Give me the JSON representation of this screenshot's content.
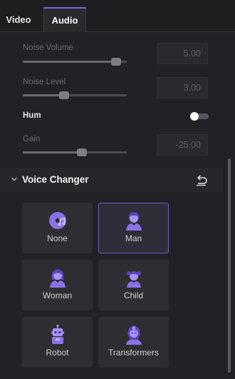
{
  "tabs": [
    {
      "label": "Video"
    },
    {
      "label": "Audio",
      "active": true
    }
  ],
  "settings": {
    "noise_volume": {
      "label": "Noise Volume",
      "value": "5.00",
      "level": 0.9
    },
    "noise_level": {
      "label": "Noise Level",
      "value": "3.00",
      "level": 0.4
    },
    "hum": {
      "label": "Hum",
      "on": false
    },
    "gain": {
      "label": "Gain",
      "value": "-25.00",
      "level": 0.57
    }
  },
  "voice_changer": {
    "title": "Voice Changer",
    "options": [
      {
        "label": "None",
        "icon": "vinyl-note-icon"
      },
      {
        "label": "Man",
        "icon": "man-icon",
        "selected": true
      },
      {
        "label": "Woman",
        "icon": "woman-icon"
      },
      {
        "label": "Child",
        "icon": "child-icon"
      },
      {
        "label": "Robot",
        "icon": "robot-icon"
      },
      {
        "label": "Transformers",
        "icon": "transformer-icon"
      }
    ]
  },
  "colors": {
    "accent": "#6d5fc7",
    "icon_purple": "#8a72e6",
    "background": "#222226"
  }
}
